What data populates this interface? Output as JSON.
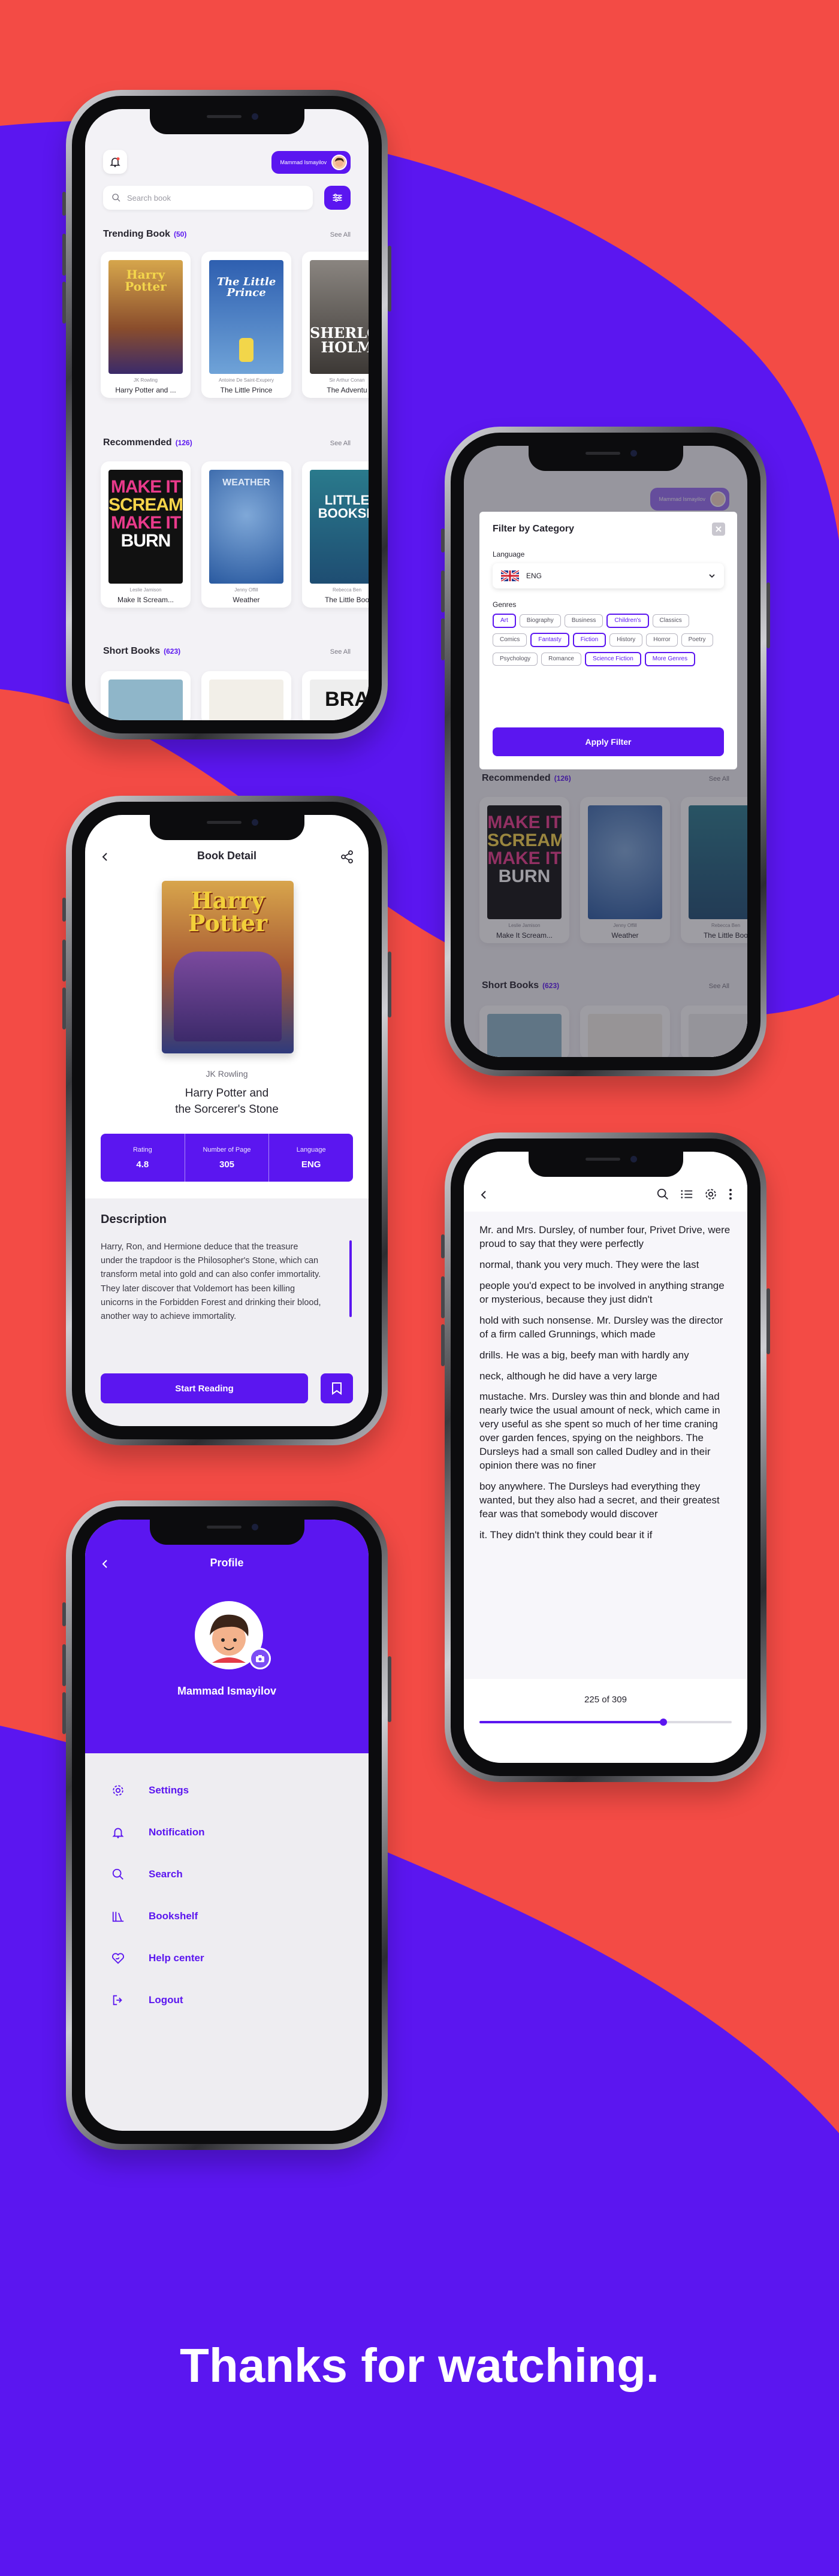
{
  "colors": {
    "primary": "#5b16f0",
    "accent_bg": "#f34b45"
  },
  "footer": {
    "thanks": "Thanks for watching."
  },
  "home": {
    "user_name": "Mammad Ismayilov",
    "search_placeholder": "Search book",
    "trending": {
      "title": "Trending Book",
      "count": "(50)",
      "see_all": "See All",
      "books": [
        {
          "author": "JK Rowling",
          "title": "Harry Potter and ..."
        },
        {
          "author": "Antoine De Saint-Exupery",
          "title": "The Little Prince"
        },
        {
          "author": "Sir Arthur Conan",
          "title": "The Adventu"
        }
      ]
    },
    "recommended": {
      "title": "Recommended",
      "count": "(126)",
      "see_all": "See All",
      "books": [
        {
          "author": "Leslie Jamison",
          "title": "Make It Scream..."
        },
        {
          "author": "Jenny Offill",
          "title": "Weather"
        },
        {
          "author": "Rebecca Ben",
          "title": "The Little Boo"
        }
      ]
    },
    "short": {
      "title": "Short Books",
      "count": "(623)",
      "see_all": "See All"
    }
  },
  "filter": {
    "title": "Filter by Category",
    "language_label": "Language",
    "language_value": "ENG",
    "genres_label": "Genres",
    "genres": [
      {
        "label": "Art",
        "on": true
      },
      {
        "label": "Biography",
        "on": false
      },
      {
        "label": "Business",
        "on": false
      },
      {
        "label": "Children's",
        "on": true
      },
      {
        "label": "Classics",
        "on": false
      },
      {
        "label": "Comics",
        "on": false
      },
      {
        "label": "Fantasty",
        "on": true
      },
      {
        "label": "Fiction",
        "on": true
      },
      {
        "label": "History",
        "on": false
      },
      {
        "label": "Horror",
        "on": false
      },
      {
        "label": "Poetry",
        "on": false
      },
      {
        "label": "Psychology",
        "on": false
      },
      {
        "label": "Romance",
        "on": false
      },
      {
        "label": "Science Fiction",
        "on": true
      },
      {
        "label": "More Genres",
        "on": true
      }
    ],
    "apply_label": "Apply Filter"
  },
  "detail": {
    "header": "Book Detail",
    "author": "JK Rowling",
    "title_line1": "Harry Potter and",
    "title_line2": "the Sorcerer's Stone",
    "rating_label": "Rating",
    "rating": "4.8",
    "pages_label": "Number of Page",
    "pages": "305",
    "language_label": "Language",
    "language": "ENG",
    "desc_title": "Description",
    "description": "Harry, Ron, and Hermione deduce that the treasure under the trapdoor is the Philosopher's Stone, which can transform metal into gold and can also confer immortality. They later discover that Voldemort has been killing unicorns in the Forbidden Forest and drinking their blood, another way to achieve immortality.",
    "start_label": "Start Reading"
  },
  "reader": {
    "paragraphs": [
      "Mr. and Mrs. Dursley, of number four, Privet Drive, were proud to say that they were perfectly",
      "normal, thank you very much. They were the last",
      "people you'd expect to be involved in anything strange or mysterious, because they just didn't",
      "hold with such nonsense. Mr. Dursley was the director of a firm called Grunnings, which made",
      "drills. He was a big, beefy man with hardly any",
      "neck, although he did have a very large",
      "mustache. Mrs. Dursley was thin and blonde and had nearly twice the usual amount of neck, which came in very useful as she spent so much of her time craning over garden fences, spying on the neighbors. The Dursleys had a small son called Dudley and in their opinion there was no finer",
      "boy anywhere. The Dursleys had everything they wanted, but they also had a secret, and their greatest fear was that somebody would discover",
      "it. They didn't think they could bear it if"
    ],
    "page_indicator": "225 of 309",
    "progress": 0.73
  },
  "profile": {
    "header": "Profile",
    "name": "Mammad Ismayilov",
    "menu": [
      {
        "label": "Settings",
        "icon": "gear-icon"
      },
      {
        "label": "Notification",
        "icon": "bell-icon"
      },
      {
        "label": "Search",
        "icon": "search-icon"
      },
      {
        "label": "Bookshelf",
        "icon": "bookshelf-icon"
      },
      {
        "label": "Help center",
        "icon": "help-icon"
      },
      {
        "label": "Logout",
        "icon": "logout-icon"
      }
    ]
  }
}
